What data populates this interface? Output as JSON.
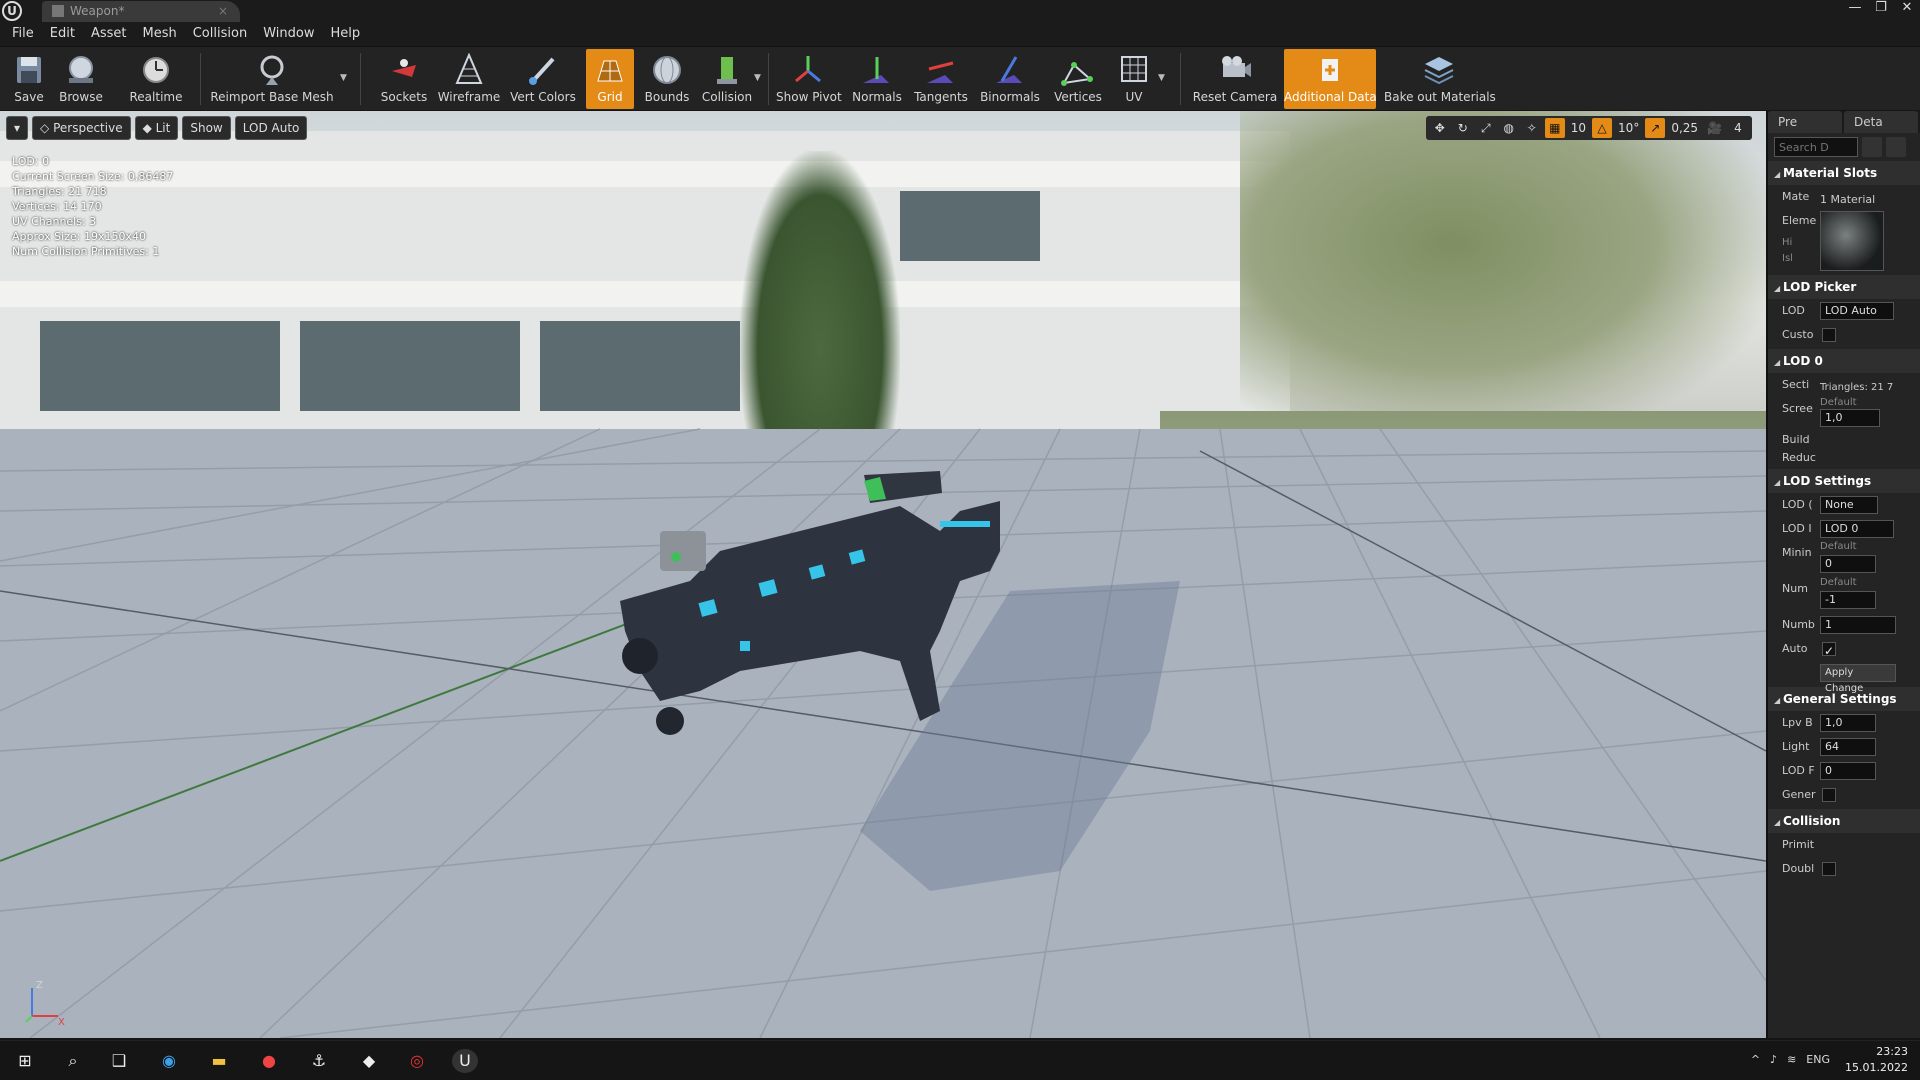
{
  "window": {
    "tab_title": "Weapon*",
    "controls": [
      "—",
      "❐",
      "✕"
    ]
  },
  "menu": [
    "File",
    "Edit",
    "Asset",
    "Mesh",
    "Collision",
    "Window",
    "Help"
  ],
  "toolbar": [
    {
      "name": "save",
      "label": "Save",
      "icon": "save-icon"
    },
    {
      "name": "browse",
      "label": "Browse",
      "icon": "browse-icon"
    },
    {
      "name": "realtime",
      "label": "Realtime",
      "icon": "realtime-icon"
    },
    {
      "name": "reimport",
      "label": "Reimport Base Mesh",
      "icon": "reimport-icon"
    },
    {
      "name": "sockets",
      "label": "Sockets",
      "icon": "sockets-icon"
    },
    {
      "name": "wireframe",
      "label": "Wireframe",
      "icon": "wireframe-icon"
    },
    {
      "name": "vert-colors",
      "label": "Vert Colors",
      "icon": "brush-icon"
    },
    {
      "name": "grid",
      "label": "Grid",
      "icon": "grid-icon",
      "active": true
    },
    {
      "name": "bounds",
      "label": "Bounds",
      "icon": "bounds-icon"
    },
    {
      "name": "collision",
      "label": "Collision",
      "icon": "collision-icon"
    },
    {
      "name": "show-pivot",
      "label": "Show Pivot",
      "icon": "pivot-icon"
    },
    {
      "name": "normals",
      "label": "Normals",
      "icon": "normals-icon"
    },
    {
      "name": "tangents",
      "label": "Tangents",
      "icon": "tangents-icon"
    },
    {
      "name": "binormals",
      "label": "Binormals",
      "icon": "binormals-icon"
    },
    {
      "name": "vertices",
      "label": "Vertices",
      "icon": "vertices-icon"
    },
    {
      "name": "uv",
      "label": "UV",
      "icon": "uv-icon"
    },
    {
      "name": "reset-camera",
      "label": "Reset Camera",
      "icon": "camera-icon"
    },
    {
      "name": "additional-data",
      "label": "Additional Data",
      "icon": "data-icon",
      "active": true
    },
    {
      "name": "bake-materials",
      "label": "Bake out Materials",
      "icon": "layers-icon"
    }
  ],
  "viewport": {
    "menu_label": "▾",
    "perspective": "Perspective",
    "lit": "Lit",
    "show": "Show",
    "lod": "LOD Auto",
    "stats": [
      "LOD:  0",
      "Current Screen Size:  0,86487",
      "Triangles:  21 718",
      "Vertices:  14 170",
      "UV Channels:  3",
      "Approx Size: 19x150x40",
      "Num Collision Primitives:  1"
    ],
    "right_tools": [
      "10",
      "10°",
      "0,25",
      "4"
    ],
    "axis": {
      "x": "X",
      "z": "Z"
    }
  },
  "panel": {
    "tabs": [
      "Pre",
      "Deta"
    ],
    "search_placeholder": "Search D",
    "material_slots": {
      "title": "Material Slots",
      "mate_label": "Mate",
      "mate_value": "1 Material",
      "elem_label": "Eleme",
      "hi": "Hi",
      "is": "Isl"
    },
    "lod_picker": {
      "title": "LOD Picker",
      "lod_label": "LOD",
      "lod_value": "LOD Auto",
      "custom_label": "Custo"
    },
    "lod0": {
      "title": "LOD 0",
      "triangles": "Triangles: 21 7",
      "sections": "Secti",
      "screen_label": "Scree",
      "screen_default": "Default",
      "screen_value": "1,0",
      "build": "Build",
      "reduce": "Reduc"
    },
    "lod_settings": {
      "title": "LOD Settings",
      "lod_group_label": "LOD (",
      "lod_group_value": "None",
      "lod_import_label": "LOD I",
      "lod_import_value": "LOD 0",
      "min_label": "Minin",
      "min_default": "Default",
      "min_value": "0",
      "num_label": "Num",
      "num_default": "Default",
      "num_value": "-1",
      "numb_label": "Numb",
      "numb_value": "1",
      "auto_label": "Auto",
      "apply": "Apply Change"
    },
    "general_settings": {
      "title": "General Settings",
      "lpv_label": "Lpv B",
      "lpv_value": "1,0",
      "light_label": "Light",
      "light_value": "64",
      "lodf_label": "LOD F",
      "lodf_value": "0",
      "gener_label": "Gener"
    },
    "collision": {
      "title": "Collision",
      "prim_label": "Primit",
      "doubl_label": "Doubl"
    }
  },
  "taskbar": {
    "lang": "ENG",
    "time": "23:23",
    "date": "15.01.2022"
  },
  "colors": {
    "accent": "#e48a16",
    "toolbar_bg": "#232323",
    "panel_bg": "#242424"
  }
}
